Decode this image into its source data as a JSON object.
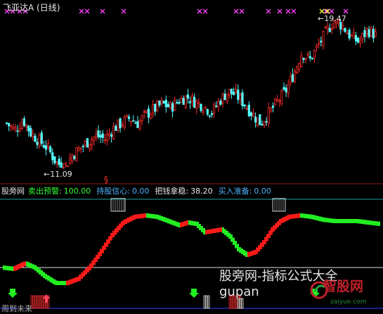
{
  "header": {
    "title": "飞亚达A (日线)"
  },
  "price_annotations": {
    "high": "19.47",
    "low": "11.09"
  },
  "indicator_bar": {
    "name": "股旁网",
    "sell_warning_label": "卖出预警:",
    "sell_warning_value": "100.00",
    "hold_confidence_label": "持股信心:",
    "hold_confidence_value": "0.00",
    "steady_label": "把钱拿稳:",
    "steady_value": "38.20",
    "buy_ready_label": "买入准备:",
    "buy_ready_value": "0.00"
  },
  "marker_symbol": "§",
  "watermark": {
    "line1": "股旁网-指标公式大全",
    "line2": "gupan"
  },
  "logo": {
    "name": "智股网",
    "site": "zaiyue.com"
  },
  "bottom_label": "周到未来",
  "colors": {
    "up": "#ff2a2a",
    "down": "#55ffff",
    "wave_red": "#ff1a1a",
    "wave_green": "#22ee22",
    "magenta": "#ff40ff",
    "yellow": "#ffff40",
    "baseline": "#e0e0e0",
    "panel_line": "#30c0c0"
  },
  "chart_data": {
    "type": "candlestick",
    "title": "飞亚达A (日线)",
    "close_path": [
      13.6,
      13.2,
      13.8,
      13.0,
      12.6,
      12.2,
      11.4,
      11.09,
      11.8,
      12.2,
      12.6,
      12.9,
      12.7,
      13.3,
      13.6,
      13.9,
      13.6,
      14.1,
      14.4,
      14.7,
      14.5,
      14.9,
      15.1,
      14.8,
      14.6,
      14.2,
      14.9,
      15.4,
      15.2,
      14.7,
      14.1,
      13.6,
      14.2,
      14.8,
      15.4,
      16.4,
      17.6,
      17.2,
      18.0,
      18.8,
      19.47,
      19.1,
      18.5,
      18.2,
      18.9,
      18.6
    ],
    "high_label": 19.47,
    "low_label": 11.09,
    "indicator": {
      "sell_warning": 100.0,
      "hold_confidence": 0.0,
      "steady": 38.2,
      "buy_ready": 0.0
    }
  }
}
